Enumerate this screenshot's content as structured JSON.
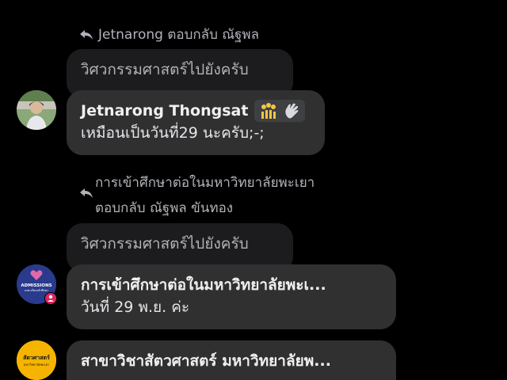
{
  "thread": {
    "reply1": {
      "header": "Jetnarong ตอบกลับ ณัฐพล",
      "quoted": "วิศวกรรมศาสตร์ไปยังครับ",
      "sender": "Jetnarong Thongsat",
      "message": "เหมือนเป็นวันที่29 นะครับ;-;"
    },
    "reply2": {
      "header_line1": "การเข้าศึกษาต่อในมหาวิทยาลัยพะเยา",
      "header_line2": "ตอบกลับ ณัฐพล ขันทอง",
      "quoted": "วิศวกรรมศาสตร์ไปยังครับ",
      "sender": "การเข้าศึกษาต่อในมหาวิทยาลัยพะเ...",
      "message": "วันที่ 29 พ.ย. ค่ะ",
      "avatar_label": "ADMISSIONS",
      "avatar_sublabel": "ลงทะเบียนเข้าศึกษา"
    },
    "reply3": {
      "sender": "สาขาวิชาสัตวศาสตร์ มหาวิทยาลัยพ...",
      "avatar_label": "สัตวศาสตร์",
      "avatar_sublabel": "มหาวิทยาลัยพะเยา"
    }
  },
  "colors": {
    "background": "#000000",
    "bubble": "#303030",
    "quoted_bubble": "#1c1c1e",
    "muted_text": "#b0b3b8",
    "admissions_avatar": "#2a3a8c",
    "animal_avatar": "#f5b400"
  }
}
